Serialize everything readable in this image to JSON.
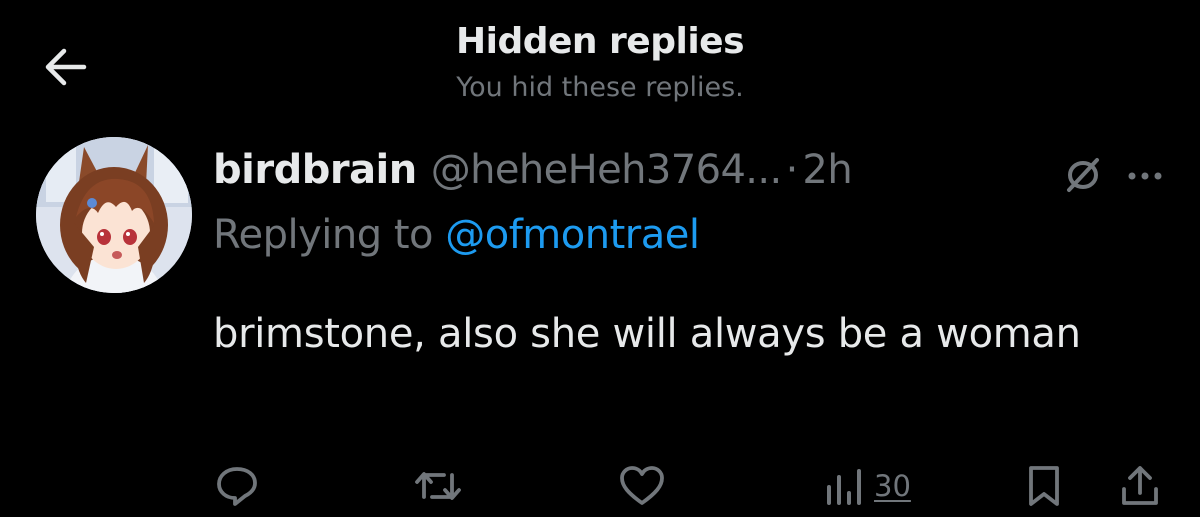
{
  "header": {
    "title": "Hidden replies",
    "subtitle": "You hid these replies."
  },
  "tweet": {
    "display_name": "birdbrain",
    "handle": "@heheHeh3764...",
    "separator": "·",
    "time": "2h",
    "replying_prefix": "Replying to",
    "replying_to": "@ofmontrael",
    "text": "brimstone, also she will always be a woman",
    "views": "30"
  },
  "icons": {
    "back": "arrow-left-icon",
    "hidden_status": "hidden-reply-icon",
    "more": "more-dots-icon",
    "reply": "reply-icon",
    "retweet": "retweet-icon",
    "like": "heart-icon",
    "views": "views-chart-icon",
    "bookmark": "bookmark-icon",
    "share": "share-icon"
  },
  "colors": {
    "background": "#000000",
    "primary_text": "#e7e9ea",
    "secondary_text": "#71767b",
    "link": "#1d9bf0"
  }
}
